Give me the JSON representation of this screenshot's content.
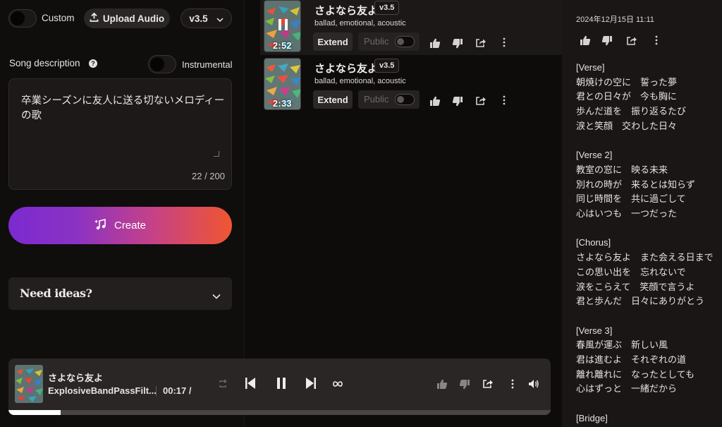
{
  "left": {
    "custom_label": "Custom",
    "upload_label": "Upload Audio",
    "version": "v3.5",
    "song_description_label": "Song description",
    "help_icon": "question-circle-icon",
    "instrumental_label": "Instrumental",
    "description_value": "卒業シーズンに友人に送る切ないメロディーの歌",
    "char_count": "22 / 200",
    "create_label": "Create",
    "ideas_label": "Need ideas?"
  },
  "songs": [
    {
      "title": "さよなら友よ",
      "version": "v3.5",
      "tags": "ballad, emotional, acoustic",
      "duration": "2:52",
      "extend_label": "Extend",
      "public_label": "Public",
      "playing": true
    },
    {
      "title": "さよなら友よ",
      "version": "v3.5",
      "tags": "ballad, emotional, acoustic",
      "duration": "2:33",
      "extend_label": "Extend",
      "public_label": "Public",
      "playing": false
    }
  ],
  "lyrics_panel": {
    "date": "2024年12月15日 11:11",
    "lyrics": "[Verse]\n朝焼けの空に　誓った夢\n君との日々が　今も胸に\n歩んだ道を　振り返るたび\n涙と笑顔　交わした日々\n\n[Verse 2]\n教室の窓に　映る未来\n別れの時が　来るとは知らず\n同じ時間を　共に過ごして\n心はいつも　一つだった\n\n[Chorus]\nさよなら友よ　また会える日まで\nこの思い出を　忘れないで\n涙をこらえて　笑顔で言うよ\n君と歩んだ　日々にありがとう\n\n[Verse 3]\n春風が運ぶ　新しい風\n君は進むよ　それぞれの道\n離れ離れに　なったとしても\n心はずっと　一緒だから\n\n[Bridge]"
  },
  "player": {
    "title": "さよなら友よ",
    "artist": "ExplosiveBandPassFilt...",
    "time": "00:17 /",
    "progress": 0.096
  }
}
